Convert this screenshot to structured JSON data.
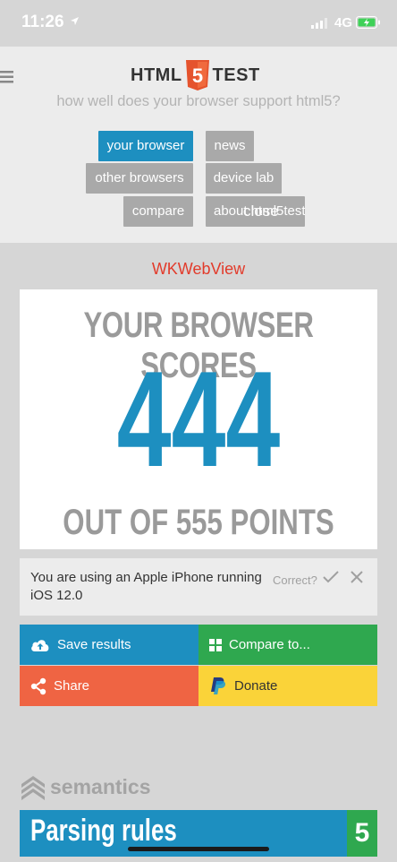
{
  "status": {
    "time": "11:26",
    "network": "4G"
  },
  "header": {
    "logo_left": "HTML",
    "logo_number": "5",
    "logo_right": "TEST",
    "tagline": "how well does your browser support html5?",
    "nav": {
      "your_browser": "your browser",
      "news": "news",
      "other_browsers": "other browsers",
      "device_lab": "device lab",
      "compare": "compare",
      "about": "about html5test",
      "close": "close"
    }
  },
  "main": {
    "engine": "WKWebView",
    "score_title": "YOUR BROWSER SCORES",
    "score": "444",
    "score_max": "OUT OF 555 POINTS",
    "device_text": "You are using an Apple iPhone running iOS 12.0",
    "correct_label": "Correct?",
    "actions": {
      "save": "Save results",
      "compare": "Compare to...",
      "share": "Share",
      "donate": "Donate"
    },
    "section": "semantics",
    "parsing_title": "Parsing rules",
    "parsing_score": "5"
  },
  "colors": {
    "accent_blue": "#1d8fc0",
    "green": "#2fa84f",
    "orange": "#ef6443",
    "yellow": "#fad339",
    "engine_red": "#e23b2b"
  }
}
